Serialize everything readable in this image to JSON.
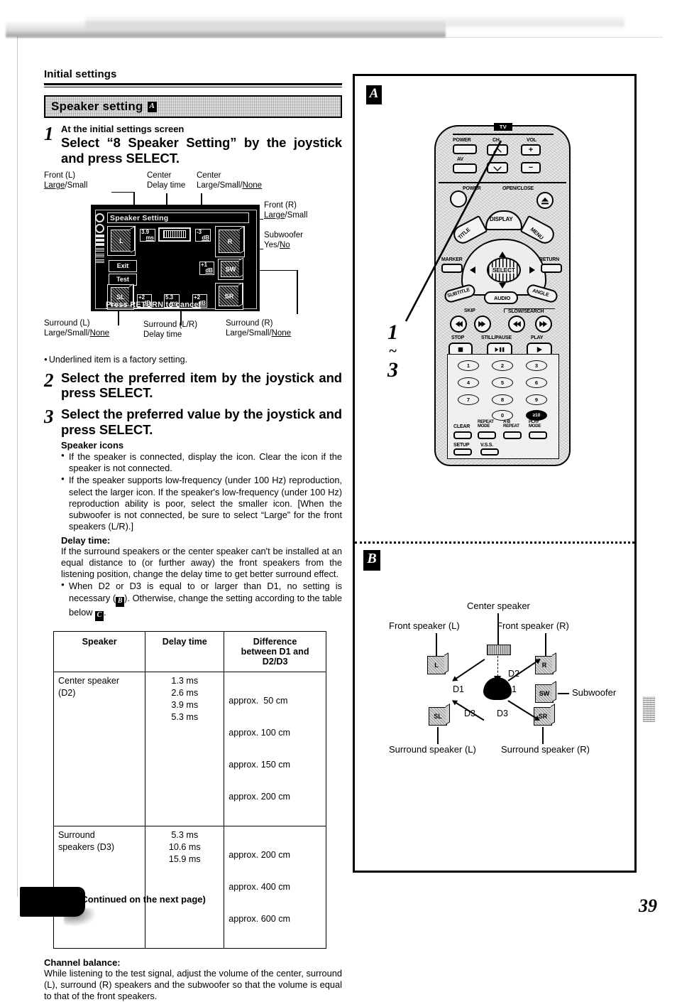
{
  "document": {
    "header": "Initial settings",
    "page_number": "39",
    "continued_note": "(Continued on the next page)"
  },
  "section": {
    "title": "Speaker setting",
    "ref": "A"
  },
  "steps": [
    {
      "num": "1",
      "sub": "At the initial settings screen",
      "main": "Select “8 Speaker Setting” by the joystick and press SELECT."
    },
    {
      "num": "2",
      "main": "Select the preferred item by the joystick and press SELECT."
    },
    {
      "num": "3",
      "main": "Select the preferred value by the joystick and press SELECT."
    }
  ],
  "osd_callouts": {
    "front_l": {
      "line1": "Front (L)",
      "line2_a": "Large",
      "line2_b": "/Small"
    },
    "center_delay": {
      "line1": "Center",
      "line2": "Delay time"
    },
    "center_size": {
      "line1": "Center",
      "line2_a": "Large/Small/",
      "line2_b": "None"
    },
    "front_r": {
      "line1": "Front (R)",
      "line2_a": "Large",
      "line2_b": "/Small"
    },
    "subwoofer": {
      "line1": "Subwoofer",
      "line2_a": "Yes/",
      "line2_b": "No"
    },
    "surround_l": {
      "line1": "Surround (L)",
      "line2_a": "Large/Small/",
      "line2_b": "None"
    },
    "surround_lr": {
      "line1": "Surround (L/R)",
      "line2": "Delay time"
    },
    "surround_r": {
      "line1": "Surround (R)",
      "line2_a": "Large/Small/",
      "line2_b": "None"
    },
    "footnote": "Underlined item is a factory setting."
  },
  "osd_screen": {
    "title": "Speaker Setting",
    "footer": "Press RETURN to cancel",
    "buttons": {
      "exit": "Exit",
      "test": "Test"
    },
    "icons": {
      "front_l": "L",
      "front_r": "R",
      "subwoofer": "SW",
      "surround_l": "SL",
      "surround_r": "SR"
    },
    "values": {
      "center_delay": "3.9",
      "center_delay_unit": "ms",
      "center_db": "-3",
      "center_db_unit": "dB",
      "subwoofer_db": "+1",
      "subwoofer_db_unit": "dB",
      "surround_l_db": "+2",
      "surround_l_db_unit": "dB",
      "surround_delay": "5.3",
      "surround_delay_unit": "ms",
      "surround_r_db": "+2",
      "surround_r_db_unit": "dB"
    }
  },
  "speaker_icons_section": {
    "heading": "Speaker icons",
    "bullets": [
      "If the speaker is connected, display the icon. Clear the icon if the speaker is not connected.",
      "If the speaker supports low-frequency (under 100 Hz) reproduction, select the larger icon. If the speaker's low-frequency (under 100 Hz) reproduction ability is poor, select the smaller icon. [When the subwoofer is not connected, be sure to select “Large” for the front speakers (L/R).]"
    ]
  },
  "delay_time_section": {
    "heading": "Delay time:",
    "paragraph": "If the surround speakers or the center speaker can't be installed at an equal distance to (or further away) the front speakers from the listening position, change the delay time to get better surround effect.",
    "bullet_pre": "When D2 or D3 is equal to or larger than D1, no setting is necessary (",
    "bullet_ref1": "B",
    "bullet_mid": "). Otherwise, change the setting according to the table below ",
    "bullet_ref2": "C",
    "bullet_end": "."
  },
  "table": {
    "headers": [
      "Speaker",
      "Delay time",
      "Difference between D1 and D2/D3"
    ],
    "header3_lines": [
      "Difference",
      "between D1 and",
      "D2/D3"
    ],
    "rows": [
      {
        "speaker_lines": [
          "Center speaker",
          "(D2)"
        ],
        "delays": [
          "1.3 ms",
          "2.6 ms",
          "3.9 ms",
          "5.3 ms"
        ],
        "differences": [
          "approx.  50 cm",
          "approx. 100 cm",
          "approx. 150 cm",
          "approx. 200 cm"
        ]
      },
      {
        "speaker_lines": [
          "Surround",
          "speakers (D3)"
        ],
        "delays": [
          "5.3 ms",
          "10.6 ms",
          "15.9 ms"
        ],
        "differences": [
          "approx. 200 cm",
          "approx. 400 cm",
          "approx. 600 cm"
        ]
      }
    ]
  },
  "channel_balance": {
    "heading": "Channel balance:",
    "paragraph": "While listening to the test signal, adjust the volume of the center, surround (L), surround (R) speakers and the subwoofer so that the volume is equal to that of the front speakers."
  },
  "panel": {
    "label_a": "A",
    "label_b": "B",
    "step_range_top": "1",
    "step_range_tilde": "~",
    "step_range_bottom": "3"
  },
  "remote": {
    "tv_badge": "TV",
    "labels": {
      "power_tv": "POWER",
      "ch": "CH",
      "vol": "VOL",
      "av": "AV",
      "power": "POWER",
      "open_close": "OPEN/CLOSE",
      "title": "TITLE",
      "display": "DISPLAY",
      "menu": "MENU",
      "marker": "MARKER",
      "select": "SELECT",
      "return": "RETURN",
      "subtitle": "SUBTITLE",
      "audio": "AUDIO",
      "angle": "ANGLE",
      "skip": "SKIP",
      "slow_search": "SLOW/SEARCH",
      "stop": "STOP",
      "still_pause": "STILL/PAUSE",
      "play": "PLAY",
      "clear": "CLEAR",
      "repeat_mode": "REPEAT MODE",
      "ab_repeat": "A-B REPEAT",
      "play_mode": "PLAY MODE",
      "setup": "SETUP",
      "vss": "V.S.S.",
      "vol_plus": "+",
      "vol_minus": "−"
    },
    "numpad": [
      "1",
      "2",
      "3",
      "4",
      "5",
      "6",
      "7",
      "8",
      "9",
      "0",
      "≥10"
    ]
  },
  "layout_diagram": {
    "labels": {
      "center_speaker": "Center speaker",
      "front_l": "Front speaker (L)",
      "front_r": "Front speaker (R)",
      "subwoofer": "Subwoofer",
      "surround_l": "Surround speaker (L)",
      "surround_r": "Surround speaker (R)"
    },
    "distances": {
      "d1_left": "D1",
      "d1_right": "D1",
      "d2": "D2",
      "d3_left": "D3",
      "d3_right": "D3"
    },
    "icons": {
      "front_l": "L",
      "front_r": "R",
      "subwoofer": "SW",
      "surround_l": "SL",
      "surround_r": "SR"
    }
  }
}
